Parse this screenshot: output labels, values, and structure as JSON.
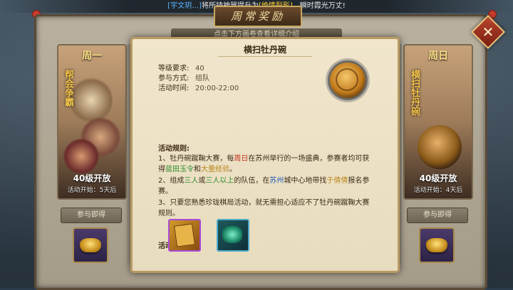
{
  "marquee": {
    "player": "[宇文玥…]",
    "text1": "将所持神器提升为",
    "item": "[绝情裂影]",
    "text2": "，瞬时霞光万丈!"
  },
  "window": {
    "title": "周常奖励",
    "subtitle": "点击下方画卷查看详细介绍"
  },
  "left_card": {
    "day": "周一",
    "name": "帮会争霸",
    "level": "40级开放",
    "start": "活动开始：5天后",
    "join": "参与即得"
  },
  "right_card": {
    "day": "周日",
    "name": "横扫牡丹碗",
    "level": "40级开放",
    "start": "活动开始：4天后",
    "join": "参与即得"
  },
  "popup": {
    "title": "横扫牡丹碗",
    "level_label": "等级要求:",
    "level_value": "40",
    "mode_label": "参与方式:",
    "mode_value": "组队",
    "time_label": "活动时间:",
    "time_value": "20:00-22:00",
    "rules_head": "活动规则:",
    "rule1": {
      "a": "1、牡丹碗蹴鞠大赛，每",
      "b": "周日",
      "c": "在苏州举行的一场盛典，参赛者均可获得",
      "d": "蓝田玉令",
      "e": "和",
      "f": "大量经验",
      "g": "。"
    },
    "rule2": {
      "a": "2、组成",
      "b": "三人",
      "c": "或",
      "d": "三人以上",
      "e": "的队伍，在",
      "f": "苏州",
      "g": "城中心地带找",
      "h": "于倩倩",
      "i": "报名参赛。"
    },
    "rule3": "3、只要您熟悉珍珑棋局活动，就无需担心适应不了牡丹碗蹴鞠大赛规则。",
    "reward_head": "活动奖励:"
  },
  "icons": {
    "close": "close-icon",
    "emblem": "ball-emblem-icon",
    "book": "book-reward-icon",
    "jade": "jade-token-icon",
    "ingot": "gold-ingot-icon"
  }
}
